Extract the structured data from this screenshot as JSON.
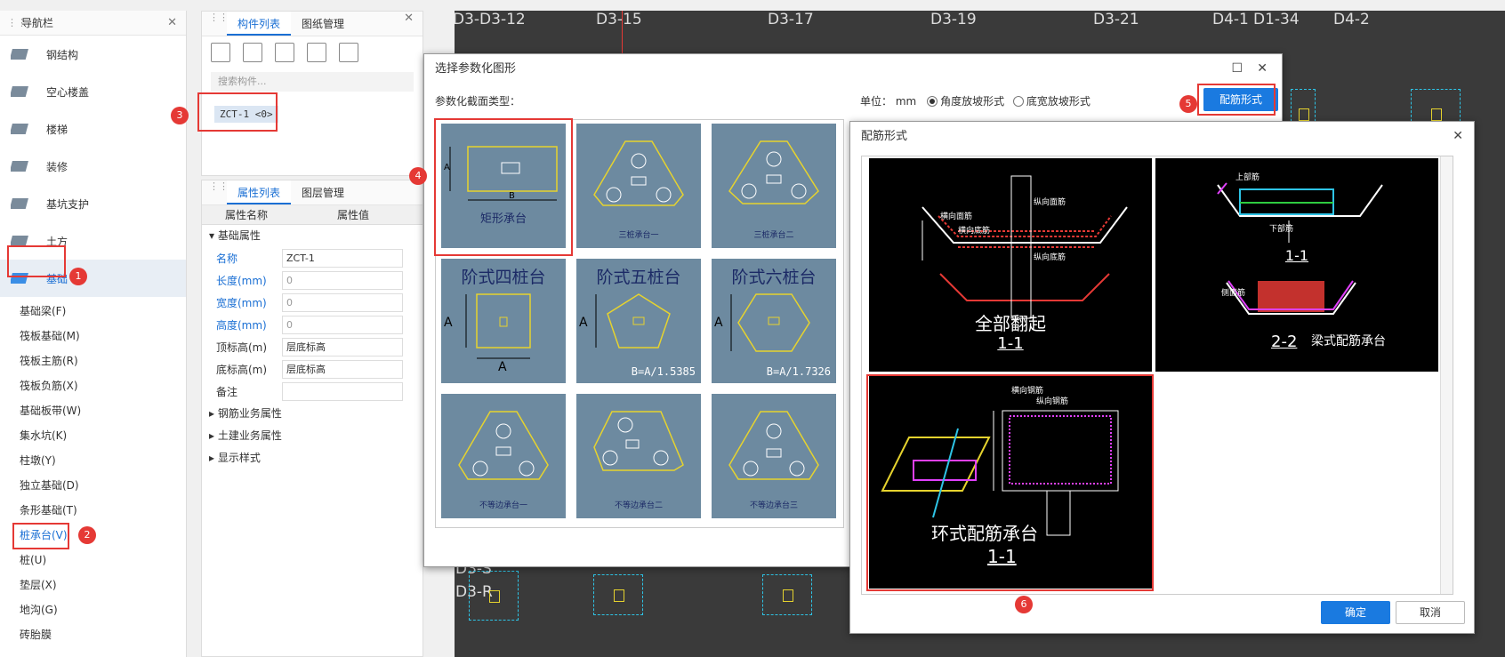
{
  "nav": {
    "title": "导航栏",
    "items": [
      {
        "label": "钢结构",
        "icon": "steel-structure-icon"
      },
      {
        "label": "空心楼盖",
        "icon": "hollow-floor-icon"
      },
      {
        "label": "楼梯",
        "icon": "stairs-icon"
      },
      {
        "label": "装修",
        "icon": "decoration-icon"
      },
      {
        "label": "基坑支护",
        "icon": "pit-support-icon"
      },
      {
        "label": "土方",
        "icon": "earthwork-icon"
      },
      {
        "label": "基础",
        "icon": "foundation-icon"
      }
    ],
    "sub_items": [
      "基础梁(F)",
      "筏板基础(M)",
      "筏板主筋(R)",
      "筏板负筋(X)",
      "基础板带(W)",
      "集水坑(K)",
      "柱墩(Y)",
      "独立基础(D)",
      "条形基础(T)",
      "桩承台(V)",
      "桩(U)",
      "垫层(X)",
      "地沟(G)",
      "砖胎膜"
    ]
  },
  "component_panel": {
    "tabs": [
      "构件列表",
      "图纸管理"
    ],
    "search_placeholder": "搜索构件...",
    "item": "ZCT-1 <0>"
  },
  "property_panel": {
    "tabs": [
      "属性列表",
      "图层管理"
    ],
    "col_name": "属性名称",
    "col_value": "属性值",
    "group_basic": "基础属性",
    "rows": [
      {
        "k": "名称",
        "v": "ZCT-1"
      },
      {
        "k": "长度(mm)",
        "v": "0"
      },
      {
        "k": "宽度(mm)",
        "v": "0"
      },
      {
        "k": "高度(mm)",
        "v": "0"
      },
      {
        "k": "顶标高(m)",
        "v": "层底标高"
      },
      {
        "k": "底标高(m)",
        "v": "层底标高"
      },
      {
        "k": "备注",
        "v": ""
      }
    ],
    "groups": [
      "钢筋业务属性",
      "土建业务属性",
      "显示样式"
    ]
  },
  "cad": {
    "top_labels": [
      "D3-D3-12",
      "D3-15",
      "D3-17",
      "D3-19",
      "D3-21",
      "D4-1",
      "D1-34",
      "D4-2"
    ],
    "left_labels": [
      "D3-S",
      "D3-R"
    ]
  },
  "dialog1": {
    "title": "选择参数化图形",
    "section_label": "参数化截面类型：",
    "unit_label": "单位：",
    "unit_value": "mm",
    "radio_angle": "角度放坡形式",
    "radio_width": "底宽放坡形式",
    "rebar_button": "配筋形式",
    "shapes": [
      {
        "caption": "矩形承台",
        "dims": [
          "A",
          "B"
        ]
      },
      {
        "caption": "三桩承台一"
      },
      {
        "caption": "三桩承台二"
      },
      {
        "caption": "阶式四桩台",
        "dims": [
          "A",
          "A"
        ]
      },
      {
        "caption": "阶式五桩台",
        "formula": "B=A/1.5385",
        "dims": [
          "A"
        ]
      },
      {
        "caption": "阶式六桩台",
        "formula": "B=A/1.7326",
        "dims": [
          "A"
        ]
      },
      {
        "caption": "不等边承台一"
      },
      {
        "caption": "不等边承台二"
      },
      {
        "caption": "不等边承台三"
      }
    ]
  },
  "dialog2": {
    "title": "配筋形式",
    "options": [
      {
        "caption": "全部翻起",
        "section": "1-1",
        "labels": [
          "横向面筋",
          "纵向面筋",
          "横向底筋",
          "纵向底筋"
        ]
      },
      {
        "caption": "梁式配筋承台",
        "section1": "1-1",
        "section2": "2-2",
        "labels": [
          "上部筋",
          "下部筋",
          "侧面筋"
        ]
      },
      {
        "caption": "环式配筋承台",
        "section": "1-1",
        "labels": [
          "横向钢筋",
          "纵向钢筋"
        ]
      }
    ],
    "ok": "确定",
    "cancel": "取消"
  },
  "badges": [
    "1",
    "2",
    "3",
    "4",
    "5",
    "6"
  ],
  "colors": {
    "accent": "#1a7ae0",
    "highlight": "#e53935",
    "cad_bg": "#3a3a3a",
    "cell_bg": "#6d8aa0"
  }
}
